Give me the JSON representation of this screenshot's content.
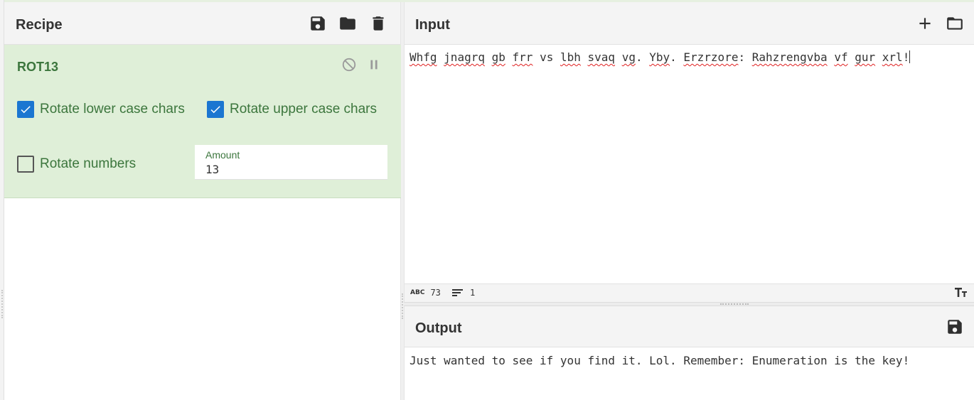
{
  "recipe": {
    "title": "Recipe",
    "icons": {
      "save": "save-icon",
      "load": "folder-icon",
      "clear": "trash-icon"
    },
    "operation": {
      "name": "ROT13",
      "icons": {
        "disable": "disable-icon",
        "breakpoint": "pause-icon"
      },
      "options": {
        "rotate_lower": {
          "label": "Rotate lower case chars",
          "checked": true
        },
        "rotate_upper": {
          "label": "Rotate upper case chars",
          "checked": true
        },
        "rotate_numbers": {
          "label": "Rotate numbers",
          "checked": false
        },
        "amount": {
          "label": "Amount",
          "value": "13"
        }
      },
      "color": "#dfefd8"
    }
  },
  "input": {
    "title": "Input",
    "icons": {
      "add": "plus-icon",
      "open": "folder-icon"
    },
    "words": [
      "Whfg",
      "jnagrq",
      "gb",
      "frr",
      "vs",
      "lbh",
      "svaq",
      "vg",
      "Yby",
      "Erzrzore",
      "Rahzrengvba",
      "vf",
      "gur",
      "xrl"
    ],
    "status": {
      "chars": "73",
      "lines": "1",
      "abc_icon": "ABC",
      "lines_icon": "lines-icon",
      "font_icon": "text-size-icon"
    }
  },
  "output": {
    "title": "Output",
    "icons": {
      "save": "save-icon"
    },
    "text": "Just wanted to see if you find it. Lol. Remember: Enumeration is the key!"
  },
  "colors": {
    "accent": "#1b76d1",
    "op_text": "#3c763d",
    "spell_error": "#e02020"
  }
}
